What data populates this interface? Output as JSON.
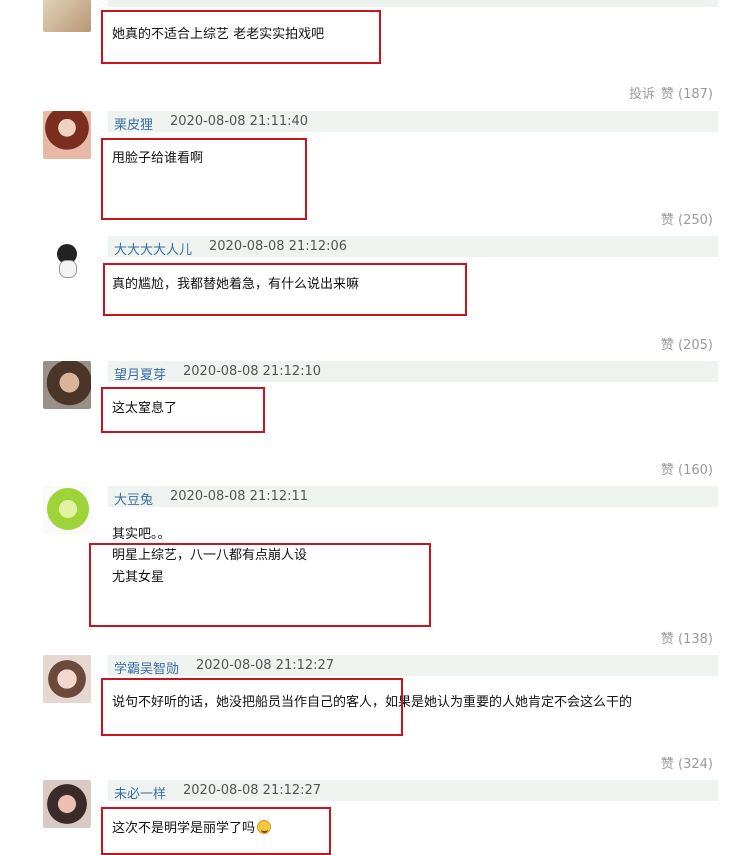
{
  "comments": [
    {
      "user": "",
      "time": "",
      "text_lines": [
        "她真的不适合上综艺 老老实实拍戏吧"
      ],
      "report_label": "投诉",
      "likes": "赞 (187)"
    },
    {
      "user": "栗皮狸",
      "time": "2020-08-08 21:11:40",
      "text_lines": [
        "甩脸子给谁看啊"
      ],
      "likes": "赞 (250)"
    },
    {
      "user": "大大大大人儿",
      "time": "2020-08-08 21:12:06",
      "text_lines": [
        "真的尴尬，我都替她着急，有什么说出来嘛"
      ],
      "likes": "赞 (205)"
    },
    {
      "user": "望月夏芽",
      "time": "2020-08-08 21:12:10",
      "text_lines": [
        "这太窒息了"
      ],
      "likes": "赞 (160)"
    },
    {
      "user": "大豆兔",
      "time": "2020-08-08 21:12:11",
      "text_lines": [
        "其实吧。。",
        "明星上综艺，八一八都有点崩人设",
        "尤其女星"
      ],
      "likes": "赞 (138)"
    },
    {
      "user": "学霸吴智勋",
      "time": "2020-08-08 21:12:27",
      "text_lines": [
        "说句不好听的话，她没把船员当作自己的客人，如果是她认为重要的人她肯定不会这么干的"
      ],
      "likes": "赞 (324)"
    },
    {
      "user": "未必一样",
      "time": "2020-08-08 21:12:27",
      "text_lines": [
        "这次不是明学是丽学了吗"
      ],
      "emoji": "grin-emoji"
    }
  ],
  "colors": {
    "highlight_box": "#c8141e",
    "username": "#3a6ea5",
    "header_bg": "#eef3ef"
  }
}
